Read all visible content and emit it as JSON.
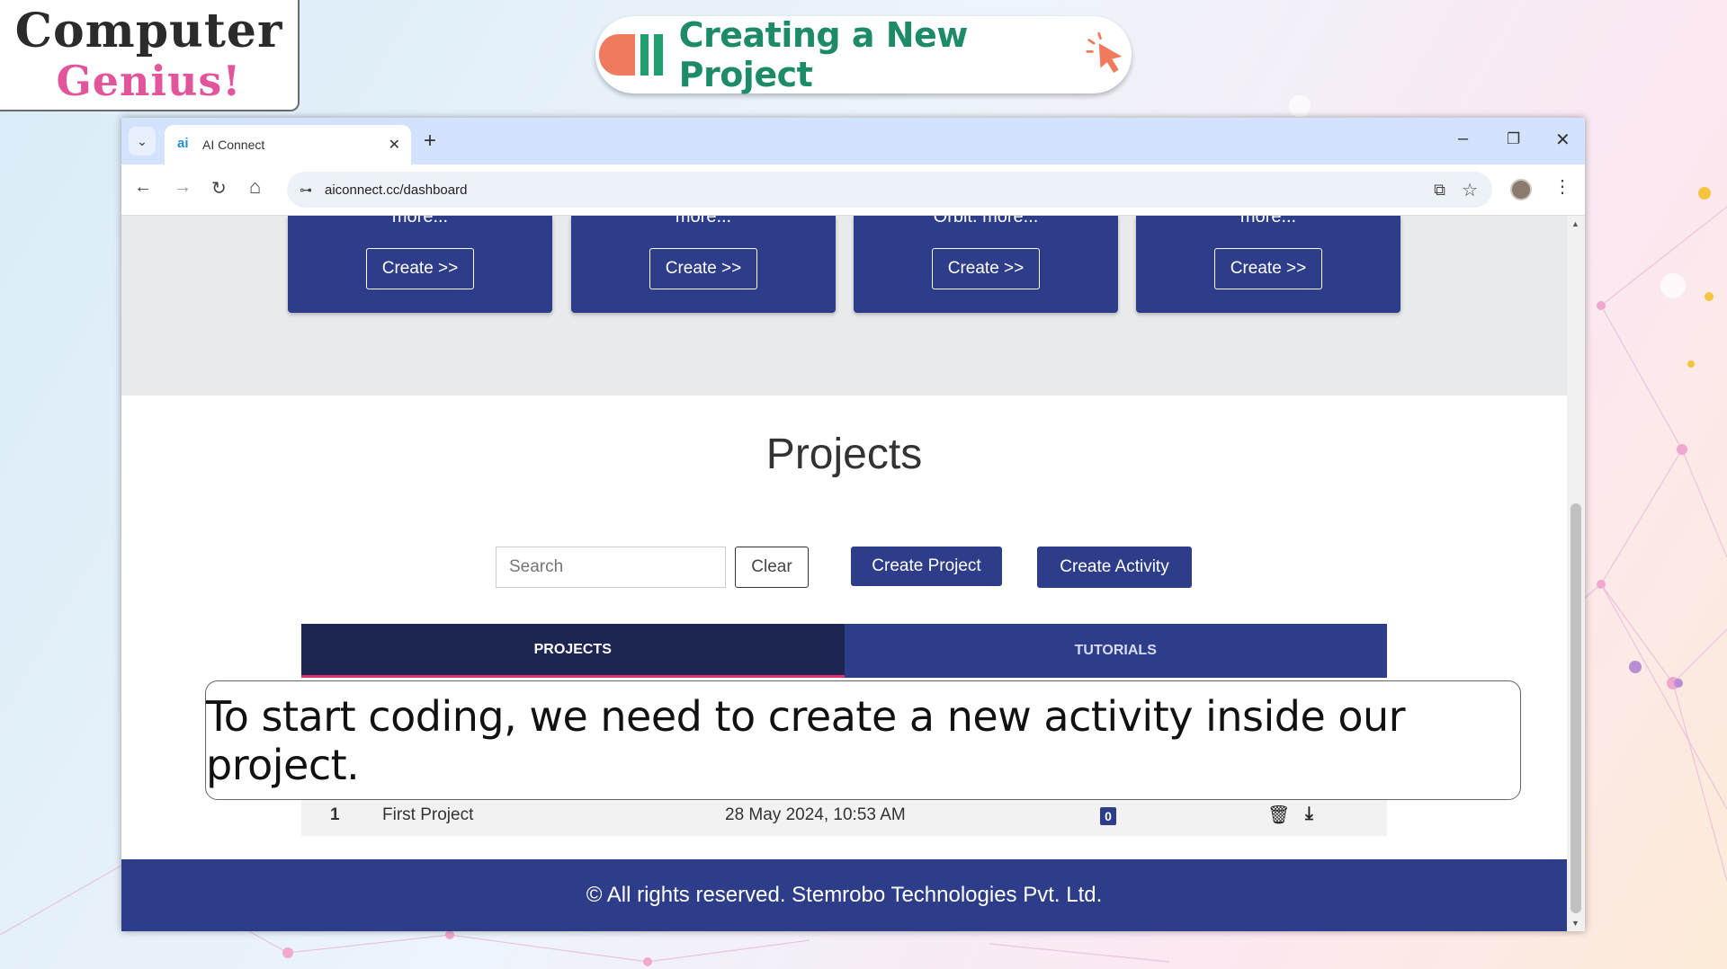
{
  "brand": {
    "line1": "Computer",
    "line2": "Genius!"
  },
  "banner": {
    "title": "Creating a New Project",
    "icon": "cursor-click-icon"
  },
  "browser": {
    "tab_title": "AI Connect",
    "favicon": "ai",
    "url": "aiconnect.cc/dashboard",
    "icons": {
      "tab_dropdown": "⌄",
      "tab_close": "✕",
      "new_tab": "+",
      "minimize": "–",
      "maximize": "❐",
      "close": "✕",
      "back": "←",
      "forward": "→",
      "reload": "↻",
      "home": "⌂",
      "site_settings": "⊶",
      "install": "⧉",
      "bookmark": "☆",
      "menu": "⋮",
      "scroll_up": "▲",
      "scroll_down": "▼"
    }
  },
  "cards": [
    {
      "more": "more...",
      "button": "Create >>"
    },
    {
      "more": "more...",
      "button": "Create >>"
    },
    {
      "more": "Orbit. more...",
      "button": "Create >>"
    },
    {
      "more": "more...",
      "button": "Create >>"
    }
  ],
  "projects": {
    "heading": "Projects",
    "search_placeholder": "Search",
    "clear_label": "Clear",
    "create_project_label": "Create Project",
    "create_activity_label": "Create Activity",
    "tabs": [
      {
        "label": "PROJECTS"
      },
      {
        "label": "TUTORIALS"
      }
    ],
    "rows": [
      {
        "index": "1",
        "name": "First Project",
        "date": "28 May 2024, 10:53 AM",
        "count": "0",
        "delete_icon": "🗑",
        "download_icon": "⤓"
      }
    ]
  },
  "footer": {
    "text": "© All rights reserved. Stemrobo Technologies Pvt. Ltd."
  },
  "caption": {
    "text": "To start coding, we need to create a new activity inside our project."
  },
  "colors": {
    "primary": "#2e3d8a",
    "dark": "#1d2652",
    "accent": "#e0336b",
    "banner_text": "#1d8a68"
  }
}
